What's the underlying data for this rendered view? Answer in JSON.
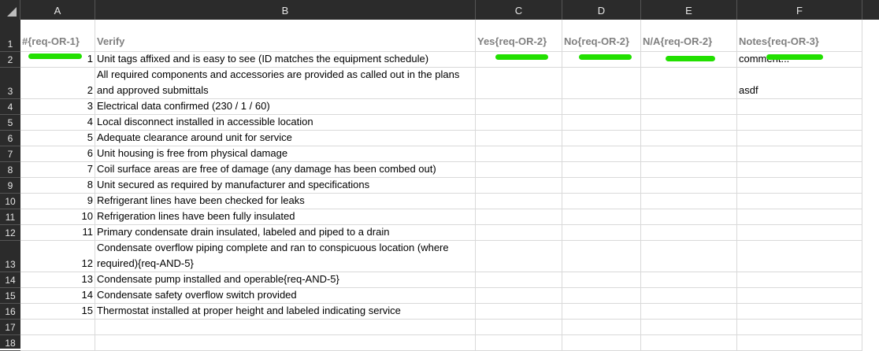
{
  "columns": [
    "A",
    "B",
    "C",
    "D",
    "E",
    "F"
  ],
  "rows": [
    "1",
    "2",
    "3",
    "4",
    "5",
    "6",
    "7",
    "8",
    "9",
    "10",
    "11",
    "12",
    "13",
    "14",
    "15",
    "16",
    "17",
    "18"
  ],
  "header": {
    "a": "#{req-OR-1}",
    "b": "Verify",
    "c": "Yes{req-OR-2}",
    "d": "No{req-OR-2}",
    "e": "N/A{req-OR-2}",
    "f": "Notes{req-OR-3}"
  },
  "items": [
    {
      "n": "1",
      "text": "Unit tags affixed and is easy to see (ID matches the equipment schedule)",
      "note": "comment..."
    },
    {
      "n": "2",
      "text": "All required components and accessories are provided as called out in the plans and approved submittals",
      "note": "asdf"
    },
    {
      "n": "3",
      "text": "Electrical data confirmed (230 / 1 / 60)",
      "note": ""
    },
    {
      "n": "4",
      "text": "Local disconnect installed in accessible location",
      "note": ""
    },
    {
      "n": "5",
      "text": "Adequate clearance around unit for service",
      "note": ""
    },
    {
      "n": "6",
      "text": "Unit housing is free from physical damage",
      "note": ""
    },
    {
      "n": "7",
      "text": "Coil surface areas are free of damage (any damage has been combed out)",
      "note": ""
    },
    {
      "n": "8",
      "text": "Unit secured as required by manufacturer and specifications",
      "note": ""
    },
    {
      "n": "9",
      "text": "Refrigerant lines have been checked for leaks",
      "note": ""
    },
    {
      "n": "10",
      "text": "Refrigeration lines have been fully insulated",
      "note": ""
    },
    {
      "n": "11",
      "text": "Primary condensate drain insulated, labeled and piped to a drain",
      "note": ""
    },
    {
      "n": "12",
      "text": "Condensate overflow piping complete and ran to conspicuous location (where required){req-AND-5}",
      "note": ""
    },
    {
      "n": "13",
      "text": "Condensate pump installed and operable{req-AND-5}",
      "note": ""
    },
    {
      "n": "14",
      "text": "Condensate safety overflow switch provided",
      "note": ""
    },
    {
      "n": "15",
      "text": "Thermostat installed at proper height and labeled indicating service",
      "note": ""
    }
  ],
  "highlight_color": "#22e000"
}
